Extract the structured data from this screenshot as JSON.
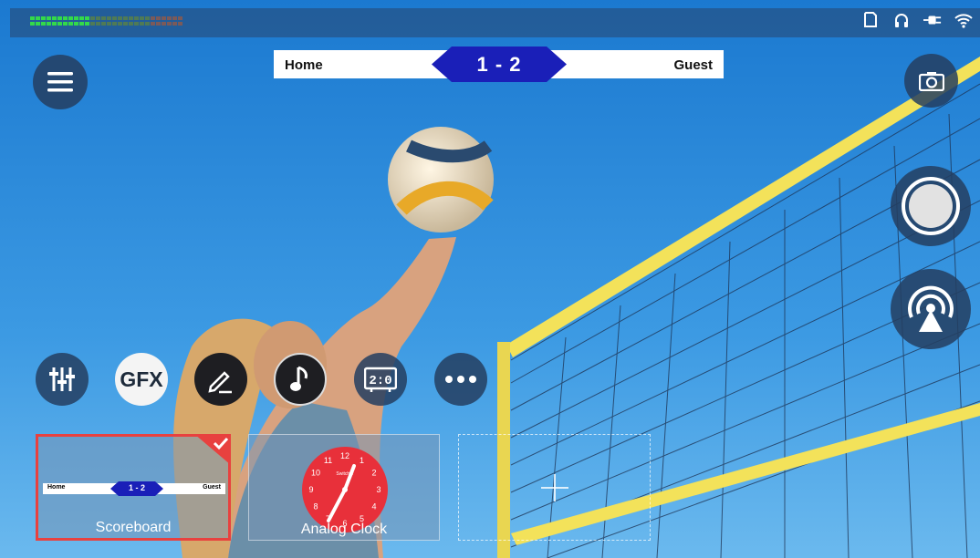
{
  "status_bar": {
    "icons": [
      "sd-card-icon",
      "headphones-icon",
      "power-plug-icon",
      "wifi-icon"
    ]
  },
  "scoreboard": {
    "home": "Home",
    "score": "1 - 2",
    "guest": "Guest",
    "accent": "#1a1fb8"
  },
  "buttons": {
    "menu": "menu-icon",
    "camera": "camera-icon",
    "record": "record-icon",
    "stream": "broadcast-icon"
  },
  "toolbar": {
    "mixer": "sliders-icon",
    "gfx_label": "GFX",
    "edit": "pencil-icon",
    "music": "music-note-icon",
    "score": "2:0",
    "more": "more-icon"
  },
  "overlays": {
    "cards": [
      {
        "label": "Scoreboard",
        "selected": true,
        "preview": {
          "home": "Home",
          "score": "1 - 2",
          "guest": "Guest"
        }
      },
      {
        "label": "Analog Clock",
        "selected": false,
        "clock_numbers": [
          "12",
          "1",
          "2",
          "3",
          "4",
          "5",
          "6",
          "7",
          "8",
          "9",
          "10",
          "11"
        ],
        "clock_brand": "Switcher"
      },
      {
        "label": "",
        "add": true
      }
    ]
  },
  "colors": {
    "selected_border": "#e8413f",
    "clock_face": "#e8303a",
    "button_bg": "#243e60"
  }
}
